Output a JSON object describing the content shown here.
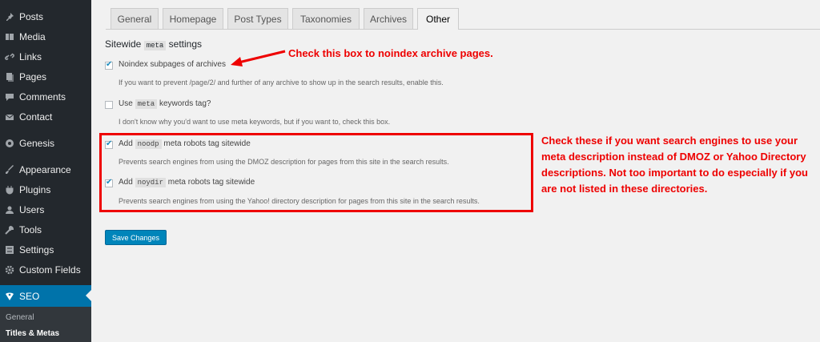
{
  "sidebar": {
    "items": [
      {
        "label": "Posts",
        "icon": "pin-icon"
      },
      {
        "label": "Media",
        "icon": "media-icon"
      },
      {
        "label": "Links",
        "icon": "link-icon"
      },
      {
        "label": "Pages",
        "icon": "pages-icon"
      },
      {
        "label": "Comments",
        "icon": "comment-icon"
      },
      {
        "label": "Contact",
        "icon": "mail-icon"
      },
      {
        "label": "Genesis",
        "icon": "genesis-icon"
      },
      {
        "label": "Appearance",
        "icon": "brush-icon"
      },
      {
        "label": "Plugins",
        "icon": "plug-icon"
      },
      {
        "label": "Users",
        "icon": "users-icon"
      },
      {
        "label": "Tools",
        "icon": "wrench-icon"
      },
      {
        "label": "Settings",
        "icon": "settings-icon"
      },
      {
        "label": "Custom Fields",
        "icon": "gear-icon"
      },
      {
        "label": "SEO",
        "icon": "seo-icon"
      }
    ],
    "submenu": [
      "General",
      "Titles & Metas"
    ]
  },
  "tabs": [
    "General",
    "Homepage",
    "Post Types",
    "Taxonomies",
    "Archives",
    "Other"
  ],
  "heading": {
    "before": "Sitewide",
    "code": "meta",
    "after": "settings"
  },
  "options": {
    "noindex": {
      "label": "Noindex subpages of archives",
      "desc": "If you want to prevent /page/2/ and further of any archive to show up in the search results, enable this.",
      "checked": true
    },
    "keywords": {
      "before": "Use",
      "code": "meta",
      "after": "keywords tag?",
      "desc": "I don't know why you'd want to use meta keywords, but if you want to, check this box.",
      "checked": false
    },
    "noodp": {
      "before": "Add",
      "code": "noodp",
      "after": "meta robots tag sitewide",
      "desc": "Prevents search engines from using the DMOZ description for pages from this site in the search results.",
      "checked": true
    },
    "noydir": {
      "before": "Add",
      "code": "noydir",
      "after": "meta robots tag sitewide",
      "desc": "Prevents search engines from using the Yahoo! directory description for pages from this site in the search results.",
      "checked": true
    }
  },
  "save_label": "Save Changes",
  "annotations": {
    "note1": "Check this box to noindex archive pages.",
    "note2": "Check these if you want search engines to use your meta description instead of DMOZ or Yahoo Directory descriptions. Not too important to do especially if you are not listed in these directories."
  },
  "colors": {
    "sidebar": "#23282d",
    "accent": "#0073aa",
    "annotation": "#e00000"
  }
}
